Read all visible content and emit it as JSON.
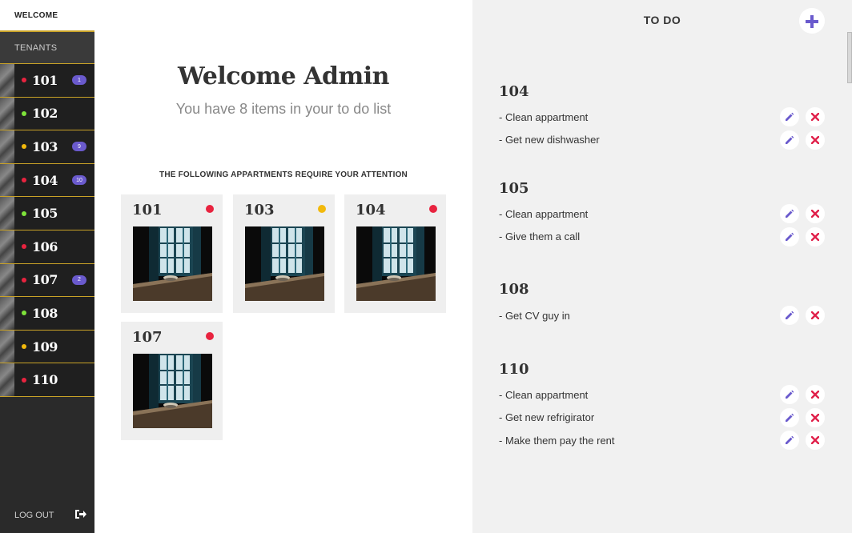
{
  "sidebar": {
    "welcome": "WELCOME",
    "tenants": "TENANTS",
    "logout": "LOG OUT",
    "apartments": [
      {
        "num": "101",
        "status": "red",
        "badge": "1"
      },
      {
        "num": "102",
        "status": "green",
        "badge": ""
      },
      {
        "num": "103",
        "status": "yellow",
        "badge": "9"
      },
      {
        "num": "104",
        "status": "red",
        "badge": "10"
      },
      {
        "num": "105",
        "status": "green",
        "badge": ""
      },
      {
        "num": "106",
        "status": "red",
        "badge": ""
      },
      {
        "num": "107",
        "status": "red",
        "badge": "2"
      },
      {
        "num": "108",
        "status": "green",
        "badge": ""
      },
      {
        "num": "109",
        "status": "yellow",
        "badge": ""
      },
      {
        "num": "110",
        "status": "red",
        "badge": ""
      }
    ]
  },
  "colors": {
    "red": "#e8233f",
    "green": "#7ee33a",
    "yellow": "#f2b90c",
    "accent": "#6a5acd",
    "gold": "#c9a227"
  },
  "main": {
    "title": "Welcome Admin",
    "subtitle": "You have 8 items in your to do list",
    "attention": "THE FOLLOWING APPARTMENTS REQUIRE YOUR ATTENTION",
    "cards": [
      {
        "num": "101",
        "status": "red"
      },
      {
        "num": "103",
        "status": "yellow"
      },
      {
        "num": "104",
        "status": "red"
      },
      {
        "num": "107",
        "status": "red"
      }
    ]
  },
  "todo": {
    "title": "TO DO",
    "add_icon": "plus-icon",
    "groups": [
      {
        "apt": "104",
        "tasks": [
          "-  Clean appartment",
          "-  Get new dishwasher"
        ]
      },
      {
        "apt": "105",
        "tasks": [
          "-  Clean appartment",
          "-  Give them a call"
        ]
      },
      {
        "apt": "108",
        "tasks": [
          "-  Get CV guy in"
        ]
      },
      {
        "apt": "110",
        "tasks": [
          "-  Clean appartment",
          "-  Get new refrigirator",
          "-  Make them pay the rent"
        ]
      }
    ]
  }
}
